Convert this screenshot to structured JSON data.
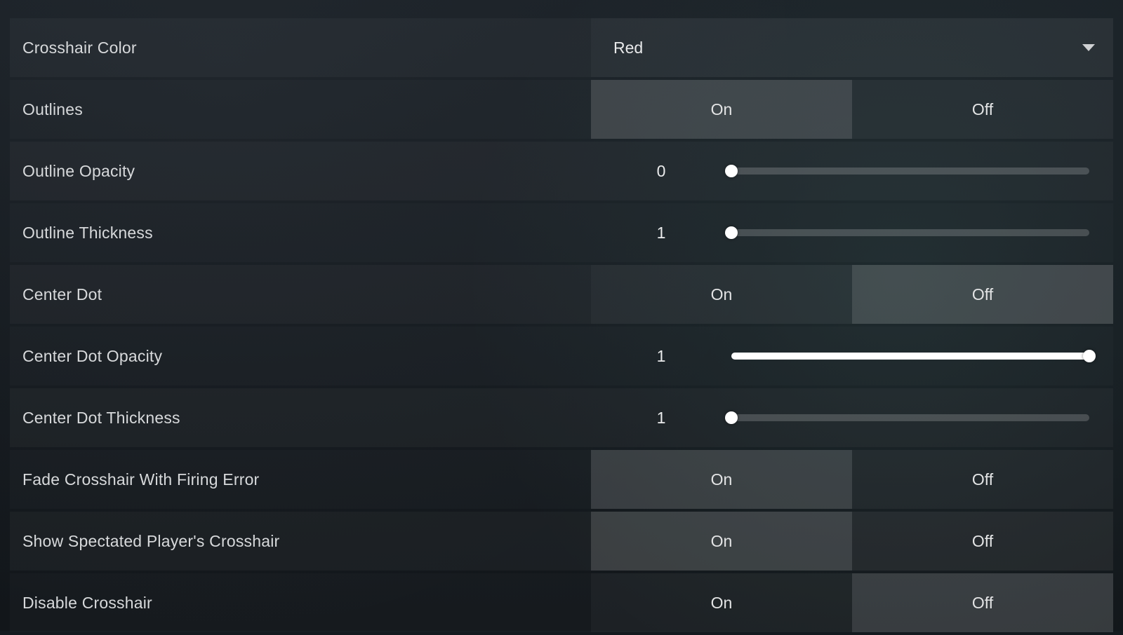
{
  "labels": {
    "on": "On",
    "off": "Off"
  },
  "rows": [
    {
      "id": "crosshair-color",
      "label": "Crosshair Color",
      "type": "dropdown",
      "value": "Red",
      "alt": true
    },
    {
      "id": "outlines",
      "label": "Outlines",
      "type": "toggle",
      "selected": "on",
      "alt": false
    },
    {
      "id": "outline-opacity",
      "label": "Outline Opacity",
      "type": "slider",
      "value": 0,
      "pct": 0,
      "alt": true
    },
    {
      "id": "outline-thickness",
      "label": "Outline Thickness",
      "type": "slider",
      "value": 1,
      "pct": 0,
      "alt": false
    },
    {
      "id": "center-dot",
      "label": "Center Dot",
      "type": "toggle",
      "selected": "off",
      "alt": true
    },
    {
      "id": "center-dot-opacity",
      "label": "Center Dot Opacity",
      "type": "slider",
      "value": 1,
      "pct": 100,
      "alt": false
    },
    {
      "id": "center-dot-thickness",
      "label": "Center Dot Thickness",
      "type": "slider",
      "value": 1,
      "pct": 0,
      "alt": true
    },
    {
      "id": "fade-crosshair",
      "label": "Fade Crosshair With Firing Error",
      "type": "toggle",
      "selected": "on",
      "alt": false
    },
    {
      "id": "show-spectated",
      "label": "Show Spectated Player's Crosshair",
      "type": "toggle",
      "selected": "on",
      "alt": true
    },
    {
      "id": "disable-crosshair",
      "label": "Disable Crosshair",
      "type": "toggle",
      "selected": "off",
      "alt": false
    }
  ]
}
